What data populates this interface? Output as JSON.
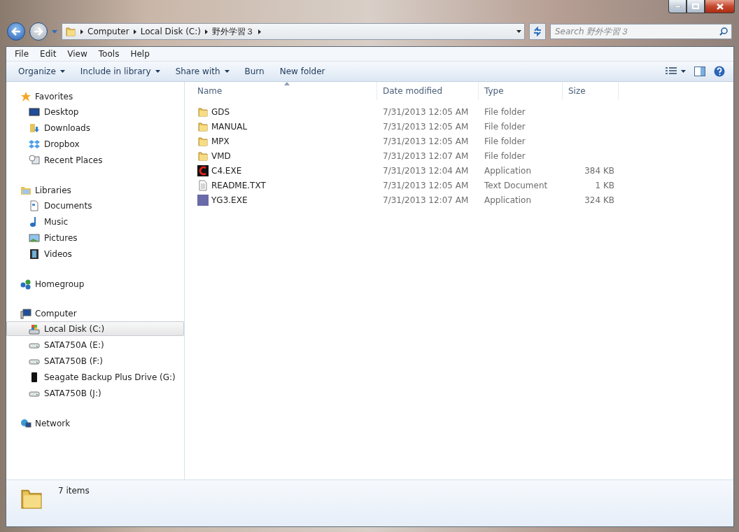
{
  "address": {
    "segments": [
      "Computer",
      "Local Disk (C:)",
      "野外学習３"
    ],
    "search_placeholder": "Search 野外学習３"
  },
  "menu": [
    "File",
    "Edit",
    "View",
    "Tools",
    "Help"
  ],
  "commands": [
    {
      "label": "Organize",
      "dropdown": true
    },
    {
      "label": "Include in library",
      "dropdown": true
    },
    {
      "label": "Share with",
      "dropdown": true
    },
    {
      "label": "Burn",
      "dropdown": false
    },
    {
      "label": "New folder",
      "dropdown": false
    }
  ],
  "sidebar": [
    {
      "label": "Favorites",
      "kind": "star",
      "children": [
        {
          "label": "Desktop",
          "kind": "desktop",
          "selected": false
        },
        {
          "label": "Downloads",
          "kind": "downloads",
          "selected": false
        },
        {
          "label": "Dropbox",
          "kind": "dropbox",
          "selected": false
        },
        {
          "label": "Recent Places",
          "kind": "recent",
          "selected": false
        }
      ]
    },
    {
      "label": "Libraries",
      "kind": "library",
      "children": [
        {
          "label": "Documents",
          "kind": "document",
          "selected": false
        },
        {
          "label": "Music",
          "kind": "music",
          "selected": false
        },
        {
          "label": "Pictures",
          "kind": "pictures",
          "selected": false
        },
        {
          "label": "Videos",
          "kind": "videos",
          "selected": false
        }
      ]
    },
    {
      "label": "Homegroup",
      "kind": "homegroup"
    },
    {
      "label": "Computer",
      "kind": "computer",
      "children": [
        {
          "label": "Local Disk (C:)",
          "kind": "sysdrive",
          "selected": true
        },
        {
          "label": "SATA750A (E:)",
          "kind": "drive",
          "selected": false
        },
        {
          "label": "SATA750B (F:)",
          "kind": "drive",
          "selected": false
        },
        {
          "label": "Seagate Backup Plus Drive (G:)",
          "kind": "external",
          "selected": false
        },
        {
          "label": "SATA750B (J:)",
          "kind": "drive",
          "selected": false
        }
      ]
    },
    {
      "label": "Network",
      "kind": "network"
    }
  ],
  "table": {
    "columns": [
      {
        "label": "Name",
        "sorted": true
      },
      {
        "label": "Date modified",
        "sorted": false
      },
      {
        "label": "Type",
        "sorted": false
      },
      {
        "label": "Size",
        "sorted": false
      }
    ],
    "rows": [
      {
        "kind": "folder",
        "name": "GDS",
        "date": "7/31/2013 12:05 AM",
        "type": "File folder"
      },
      {
        "kind": "folder",
        "name": "MANUAL",
        "date": "7/31/2013 12:05 AM",
        "type": "File folder"
      },
      {
        "kind": "folder",
        "name": "MPX",
        "date": "7/31/2013 12:05 AM",
        "type": "File folder"
      },
      {
        "kind": "folder",
        "name": "VMD",
        "date": "7/31/2013 12:07 AM",
        "type": "File folder"
      },
      {
        "kind": "app-red",
        "name": "C4.EXE",
        "date": "7/31/2013 12:04 AM",
        "type": "Application",
        "size": "384 KB"
      },
      {
        "kind": "text",
        "name": "README.TXT",
        "date": "7/31/2013 12:05 AM",
        "type": "Text Document",
        "size": "1 KB"
      },
      {
        "kind": "app-picture",
        "name": "YG3.EXE",
        "date": "7/31/2013 12:07 AM",
        "type": "Application",
        "size": "324 KB"
      }
    ]
  },
  "status_bar": {
    "count": "7 items"
  }
}
